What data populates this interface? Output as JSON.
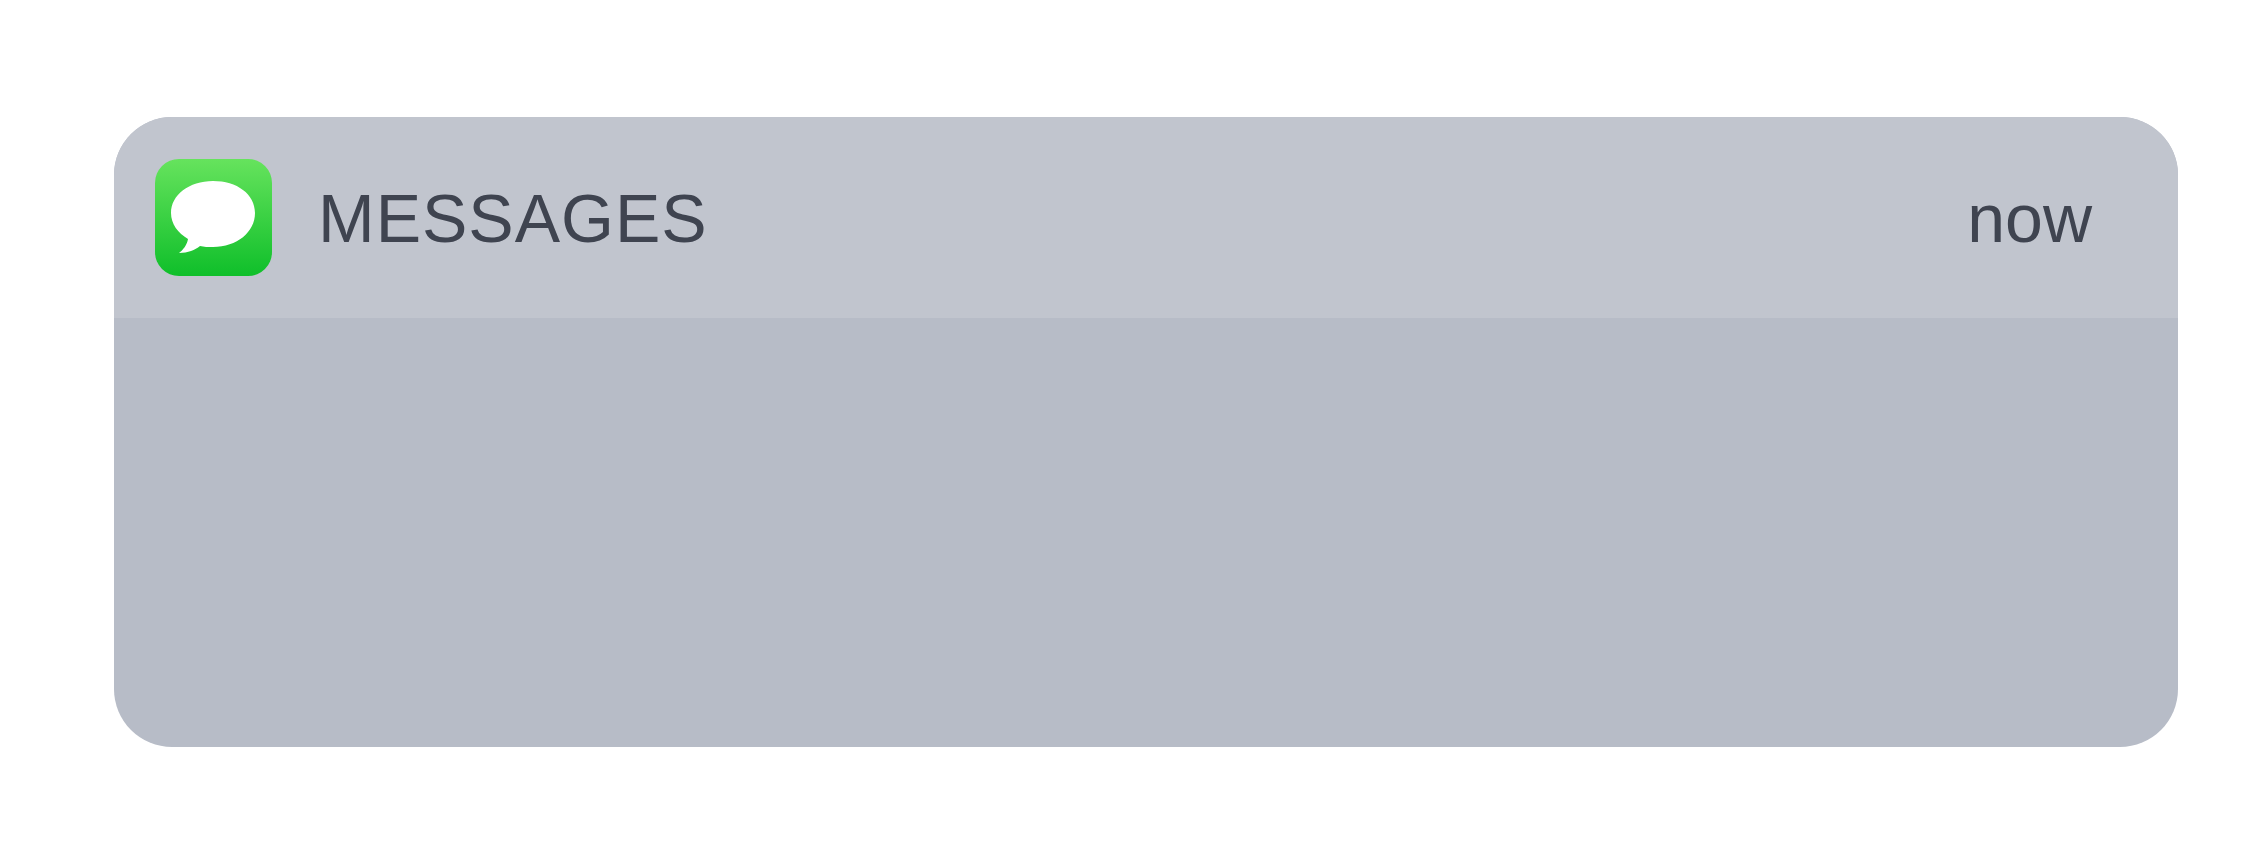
{
  "notification": {
    "app_name": "MESSAGES",
    "time": "now"
  }
}
